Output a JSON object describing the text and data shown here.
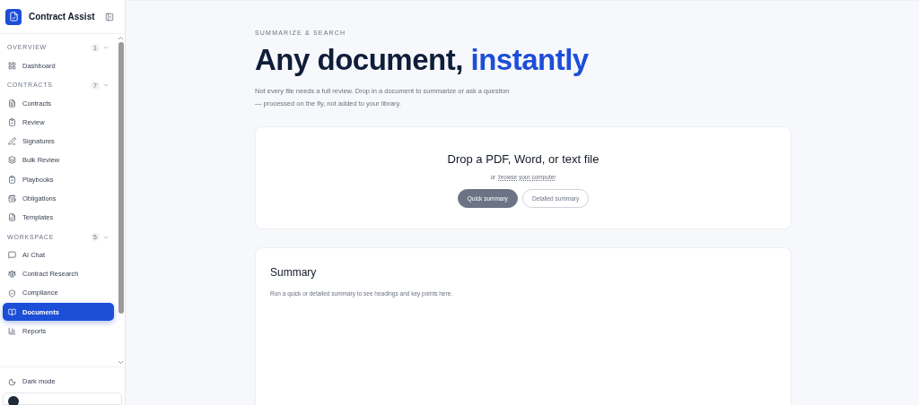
{
  "sidebar": {
    "app_name": "Contract Assist",
    "sections": [
      {
        "title": "OVERVIEW",
        "count": "1",
        "expanded": true,
        "items": [
          {
            "label": "Dashboard",
            "selected": false
          }
        ]
      },
      {
        "title": "CONTRACTS",
        "count": "7",
        "expanded": true,
        "items": [
          {
            "label": "Contracts",
            "selected": false
          },
          {
            "label": "Review",
            "selected": false
          },
          {
            "label": "Signatures",
            "selected": false
          },
          {
            "label": "Bulk Review",
            "selected": false
          },
          {
            "label": "Playbooks",
            "selected": false
          },
          {
            "label": "Obligations",
            "selected": false
          },
          {
            "label": "Templates",
            "selected": false
          }
        ]
      },
      {
        "title": "WORKSPACE",
        "count": "5",
        "expanded": true,
        "items": [
          {
            "label": "AI Chat",
            "selected": false
          },
          {
            "label": "Contract Research",
            "selected": false
          },
          {
            "label": "Compliance",
            "selected": false
          },
          {
            "label": "Documents",
            "selected": true
          },
          {
            "label": "Reports",
            "selected": false
          }
        ]
      }
    ],
    "dark_mode": {
      "label": "Dark mode"
    }
  },
  "main": {
    "eyebrow": "SUMMARIZE & SEARCH",
    "title": "Any document,",
    "title_accent": "instantly",
    "description": "Not every file needs a full review. Drop in a document to summarize or ask a question — processed on the fly, not added to your library.",
    "dropzone": {
      "title": "Drop a PDF, Word, or text file",
      "prefix": "or",
      "link": "browse your computer",
      "modes": [
        {
          "label": "Quick summary",
          "selected": true
        },
        {
          "label": "Detailed summary",
          "selected": false
        }
      ]
    },
    "summary": {
      "title": "Summary",
      "hint": "Run a quick or detailed summary to see headings and key points here."
    }
  }
}
